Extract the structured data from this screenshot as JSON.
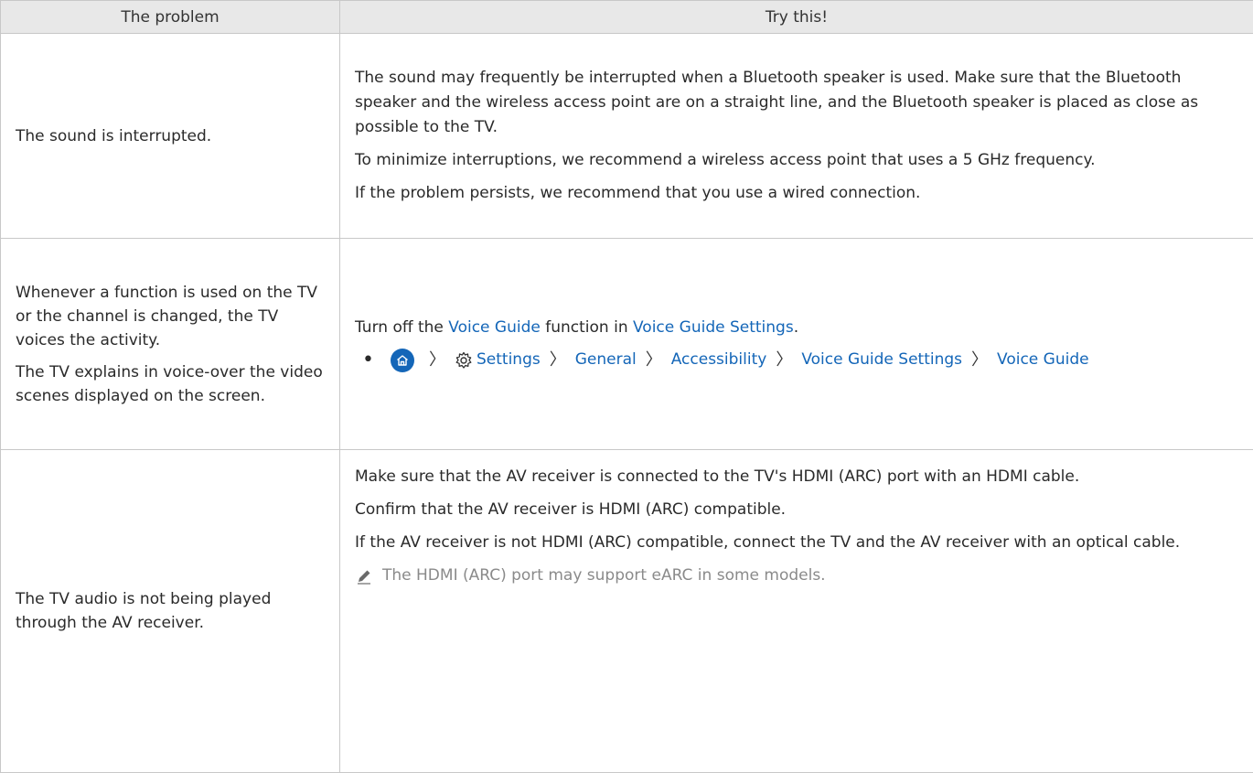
{
  "header": {
    "col1": "The problem",
    "col2": "Try this!"
  },
  "rows": [
    {
      "problem": [
        "The sound is interrupted."
      ],
      "solutions": [
        "The sound may frequently be interrupted when a Bluetooth speaker is used. Make sure that the Bluetooth speaker and the wireless access point are on a straight line, and the Bluetooth speaker is placed as close as possible to the TV.",
        "To minimize interruptions, we recommend a wireless access point that uses a 5 GHz frequency.",
        "If the problem persists, we recommend that you use a wired connection."
      ]
    },
    {
      "problem": [
        "Whenever a function is used on the TV or the channel is changed, the TV voices the activity.",
        "The TV explains in voice-over the video scenes displayed on the screen."
      ],
      "solution_intro": {
        "pre": "Turn off the ",
        "link1": "Voice Guide",
        "mid": " function in ",
        "link2": "Voice Guide Settings",
        "post": "."
      },
      "path": {
        "home_icon": "home-icon",
        "gear_icon": "gear-icon",
        "separator": "〉",
        "items": [
          "Settings",
          "General",
          "Accessibility",
          "Voice Guide Settings",
          "Voice Guide"
        ]
      }
    },
    {
      "problem": [
        "The TV audio is not being played through the AV receiver."
      ],
      "solutions": [
        "Make sure that the AV receiver is connected to the TV's HDMI (ARC) port with an HDMI cable.",
        "Confirm that the AV receiver is HDMI (ARC) compatible.",
        "If the AV receiver is not HDMI (ARC) compatible, connect the TV and the AV receiver with an optical cable."
      ],
      "note": "The HDMI (ARC) port may support eARC in some models."
    }
  ],
  "colors": {
    "link": "#1466b8",
    "header_bg": "#e8e8e8",
    "border": "#c8c8c8",
    "note": "#8a8a8a"
  }
}
